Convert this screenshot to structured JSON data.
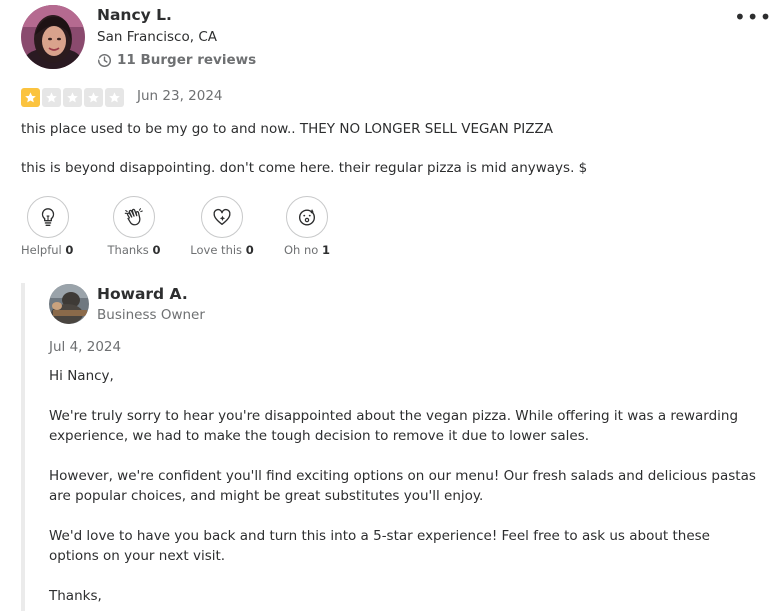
{
  "review": {
    "reviewer_name": "Nancy L.",
    "reviewer_location": "San Francisco, CA",
    "review_count": "11 Burger reviews",
    "rating": 1,
    "rating_max": 5,
    "star_color": "#fbc33f",
    "star_empty_color": "#e6e6e6",
    "date": "Jun 23, 2024",
    "paragraphs": [
      "this place used to be my go to and now.. THEY NO LONGER SELL VEGAN PIZZA",
      "this is beyond disappointing. don't come here. their regular pizza is mid anyways. $"
    ],
    "more_icon": "•••"
  },
  "reactions": [
    {
      "label": "Helpful",
      "count": "0",
      "icon": "lightbulb-icon"
    },
    {
      "label": "Thanks",
      "count": "0",
      "icon": "waving-hand-icon"
    },
    {
      "label": "Love this",
      "count": "0",
      "icon": "heart-sparkle-icon"
    },
    {
      "label": "Oh no",
      "count": "1",
      "icon": "surprised-face-icon"
    }
  ],
  "owner_reply": {
    "name": "Howard A.",
    "role": "Business Owner",
    "date": "Jul 4, 2024",
    "paragraphs": [
      "Hi Nancy,",
      "We're truly sorry to hear you're disappointed about the vegan pizza. While offering it was a rewarding experience, we had to make the tough decision to remove it due to lower sales.",
      "However, we're confident you'll find exciting options on our menu! Our fresh salads and delicious pastas are popular choices, and might be great substitutes you'll enjoy.",
      "We'd love to have you back and turn this into a 5-star experience! Feel free to ask us about these options on your next visit.",
      "Thanks,"
    ]
  }
}
